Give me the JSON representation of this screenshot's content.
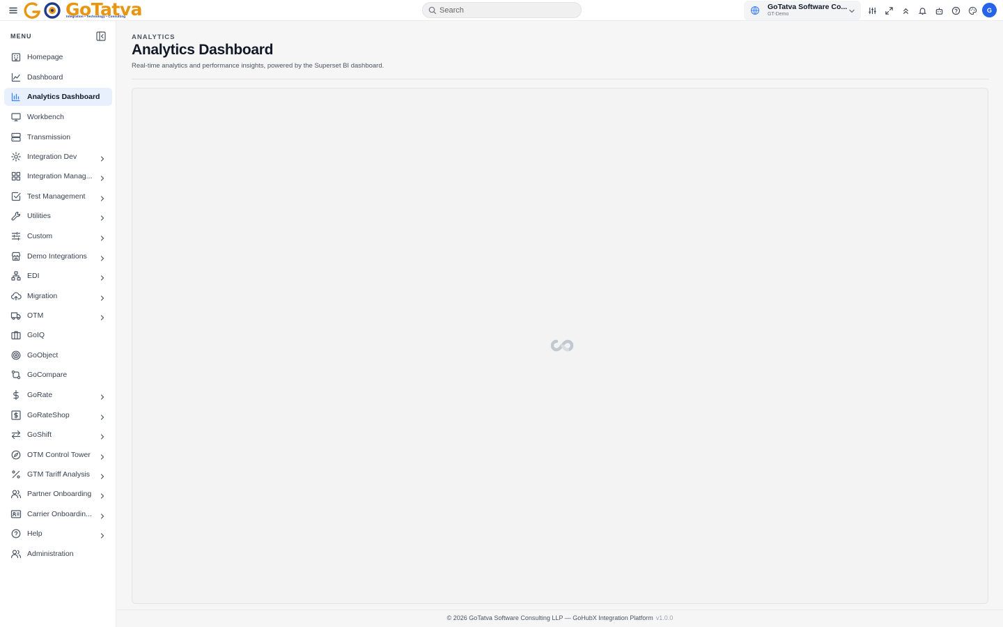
{
  "brand": {
    "logo_text": "GoTatva",
    "tagline": "Integration • Technology • Consulting",
    "colors": {
      "primary": "#2563eb",
      "logo": "#e89611",
      "active_bg": "#e8f0fe"
    }
  },
  "header": {
    "search_placeholder": "Search",
    "org_name": "GoTatva Software Co...",
    "org_sub": "GT-Demo",
    "avatar_initial": "G",
    "icons": [
      "sliders-icon",
      "expand-icon",
      "chevrons-up-icon",
      "bell-icon",
      "robot-icon",
      "help-icon",
      "palette-icon"
    ]
  },
  "sidebar": {
    "menu_label": "MENU",
    "items": [
      {
        "label": "Homepage",
        "icon": "building-icon",
        "has_children": false,
        "active": false
      },
      {
        "label": "Dashboard",
        "icon": "line-chart-icon",
        "has_children": false,
        "active": false
      },
      {
        "label": "Analytics Dashboard",
        "icon": "bar-chart-icon",
        "has_children": false,
        "active": true
      },
      {
        "label": "Workbench",
        "icon": "monitor-icon",
        "has_children": false,
        "active": false
      },
      {
        "label": "Transmission",
        "icon": "server-icon",
        "has_children": false,
        "active": false
      },
      {
        "label": "Integration Dev",
        "icon": "gear-icon",
        "has_children": true,
        "active": false
      },
      {
        "label": "Integration Manag...",
        "icon": "grid-icon",
        "has_children": true,
        "active": false
      },
      {
        "label": "Test Management",
        "icon": "check-square-icon",
        "has_children": true,
        "active": false
      },
      {
        "label": "Utilities",
        "icon": "wrench-icon",
        "has_children": true,
        "active": false
      },
      {
        "label": "Custom",
        "icon": "sliders-icon",
        "has_children": true,
        "active": false
      },
      {
        "label": "Demo Integrations",
        "icon": "store-icon",
        "has_children": true,
        "active": false
      },
      {
        "label": "EDI",
        "icon": "network-icon",
        "has_children": true,
        "active": false
      },
      {
        "label": "Migration",
        "icon": "cloud-upload-icon",
        "has_children": true,
        "active": false
      },
      {
        "label": "OTM",
        "icon": "truck-icon",
        "has_children": true,
        "active": false
      },
      {
        "label": "GoIQ",
        "icon": "briefcase-icon",
        "has_children": false,
        "active": false
      },
      {
        "label": "GoObject",
        "icon": "target-icon",
        "has_children": false,
        "active": false
      },
      {
        "label": "GoCompare",
        "icon": "git-compare-icon",
        "has_children": false,
        "active": false
      },
      {
        "label": "GoRate",
        "icon": "dollar-icon",
        "has_children": true,
        "active": false
      },
      {
        "label": "GoRateShop",
        "icon": "dollar-square-icon",
        "has_children": true,
        "active": false
      },
      {
        "label": "GoShift",
        "icon": "swap-icon",
        "has_children": true,
        "active": false
      },
      {
        "label": "OTM Control Tower",
        "icon": "compass-icon",
        "has_children": true,
        "active": false
      },
      {
        "label": "GTM Tariff Analysis",
        "icon": "percent-icon",
        "has_children": true,
        "active": false
      },
      {
        "label": "Partner Onboarding",
        "icon": "users-icon",
        "has_children": true,
        "active": false
      },
      {
        "label": "Carrier Onboardin...",
        "icon": "id-card-icon",
        "has_children": true,
        "active": false
      },
      {
        "label": "Help",
        "icon": "help-circle-icon",
        "has_children": true,
        "active": false
      },
      {
        "label": "Administration",
        "icon": "user-group-icon",
        "has_children": false,
        "active": false
      }
    ]
  },
  "main": {
    "breadcrumb": "ANALYTICS",
    "title": "Analytics Dashboard",
    "subtitle": "Real-time analytics and performance insights, powered by the Superset BI dashboard."
  },
  "footer": {
    "text": "© 2026 GoTatva Software Consulting LLP — GoHubX Integration Platform",
    "version": "v1.0.0"
  }
}
